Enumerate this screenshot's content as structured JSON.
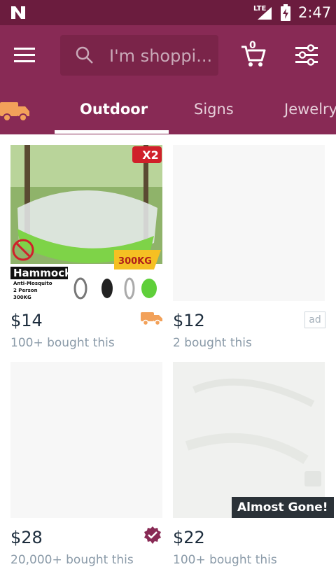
{
  "status_bar": {
    "network": "LTE",
    "time": "2:47"
  },
  "header": {
    "search_placeholder": "I'm shoppi...",
    "cart_count": "0"
  },
  "tabs": [
    {
      "label": "Outdoor",
      "active": true
    },
    {
      "label": "Signs",
      "active": false
    },
    {
      "label": "Jewelry",
      "active": false
    }
  ],
  "products": [
    {
      "price": "$14",
      "bought": "100+ bought this",
      "badge": "fast-shipping-truck-icon",
      "image_text": {
        "title": "Hammock",
        "features": [
          "Anti-Mosquito",
          "2 Person",
          "300KG"
        ],
        "weight_badge": "300KG",
        "pack_badge": "X2"
      }
    },
    {
      "price": "$12",
      "bought": "2 bought this",
      "badge_text": "ad"
    },
    {
      "price": "$28",
      "bought": "20,000+ bought this",
      "badge": "verified-check-icon"
    },
    {
      "price": "$22",
      "bought": "100+ bought this",
      "overlay": "Almost Gone!"
    }
  ],
  "colors": {
    "status_bar": "#6b1c3e",
    "app_bar": "#882a55",
    "search_bg": "#7a2449",
    "truck_orange": "#f2a15a",
    "verified": "#882a55"
  }
}
